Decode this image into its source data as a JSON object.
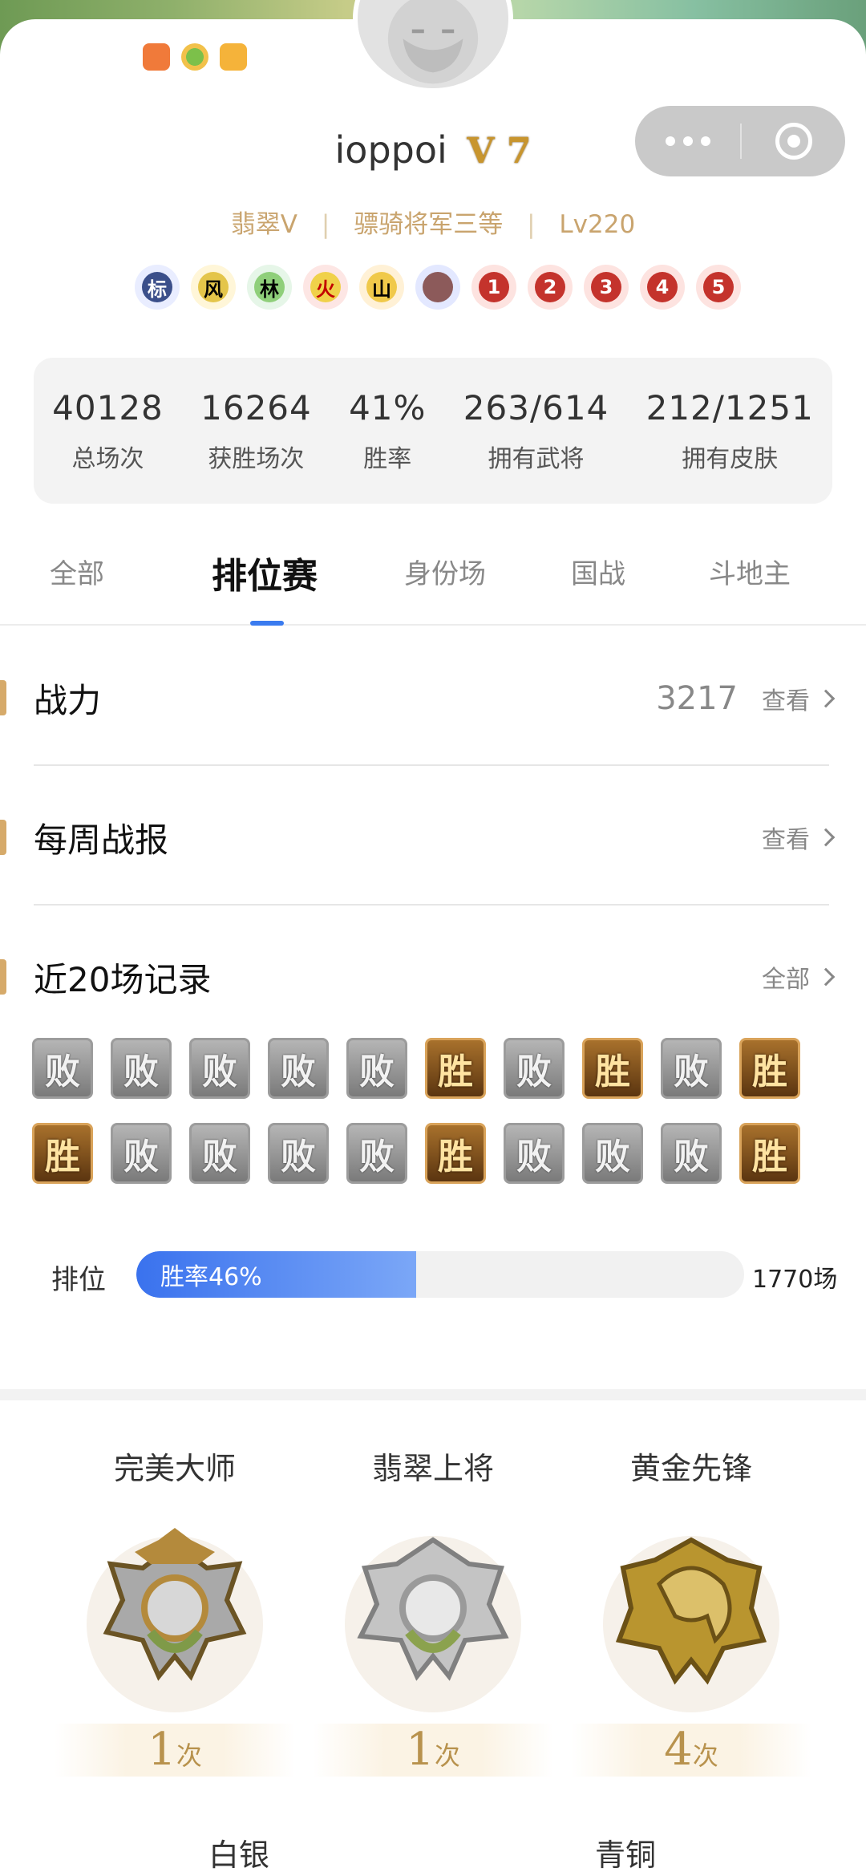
{
  "header": {
    "username": "ioppoi",
    "vip_label": "V 7",
    "meta": [
      "翡翠V",
      "骠骑将军三等",
      "Lv220"
    ],
    "badges": [
      {
        "text": "标",
        "style": "b-blue"
      },
      {
        "text": "风",
        "style": "b-yellow"
      },
      {
        "text": "林",
        "style": "b-green"
      },
      {
        "text": "火",
        "style": "b-red"
      },
      {
        "text": "山",
        "style": "b-gold"
      },
      {
        "text": "",
        "style": "b-face"
      },
      {
        "text": "1",
        "style": "b-num"
      },
      {
        "text": "2",
        "style": "b-num"
      },
      {
        "text": "3",
        "style": "b-num"
      },
      {
        "text": "4",
        "style": "b-num"
      },
      {
        "text": "5",
        "style": "b-num"
      }
    ]
  },
  "stats": [
    {
      "value": "40128",
      "label": "总场次"
    },
    {
      "value": "16264",
      "label": "获胜场次"
    },
    {
      "value": "41%",
      "label": "胜率"
    },
    {
      "value": "263/614",
      "label": "拥有武将"
    },
    {
      "value": "212/1251",
      "label": "拥有皮肤"
    }
  ],
  "tabs": [
    "全部",
    "排位赛",
    "身份场",
    "国战",
    "斗地主"
  ],
  "active_tab": "排位赛",
  "sections": {
    "power": {
      "title": "战力",
      "value": "3217",
      "link": "查看"
    },
    "weekly": {
      "title": "每周战报",
      "link": "查看"
    },
    "recent": {
      "title": "近20场记录",
      "link": "全部"
    }
  },
  "records": {
    "row1": [
      "败",
      "败",
      "败",
      "败",
      "败",
      "胜",
      "败",
      "胜",
      "败",
      "胜"
    ],
    "row2": [
      "胜",
      "败",
      "败",
      "败",
      "败",
      "胜",
      "败",
      "败",
      "败",
      "胜"
    ]
  },
  "rank": {
    "label": "排位",
    "win_rate_text": "胜率46%",
    "win_rate": 0.46,
    "count": "1770场"
  },
  "medals": [
    {
      "name": "完美大师",
      "count": "1",
      "unit": "次",
      "tone": "gold-silver"
    },
    {
      "name": "翡翠上将",
      "count": "1",
      "unit": "次",
      "tone": "silver"
    },
    {
      "name": "黄金先锋",
      "count": "4",
      "unit": "次",
      "tone": "gold"
    }
  ],
  "next_labels": [
    "白银",
    "青铜"
  ],
  "colors": {
    "accent": "#3a7bef",
    "gold_text": "#c9a46e",
    "win_tile": "#8a5a22",
    "lose_tile": "#8f8f8f"
  }
}
